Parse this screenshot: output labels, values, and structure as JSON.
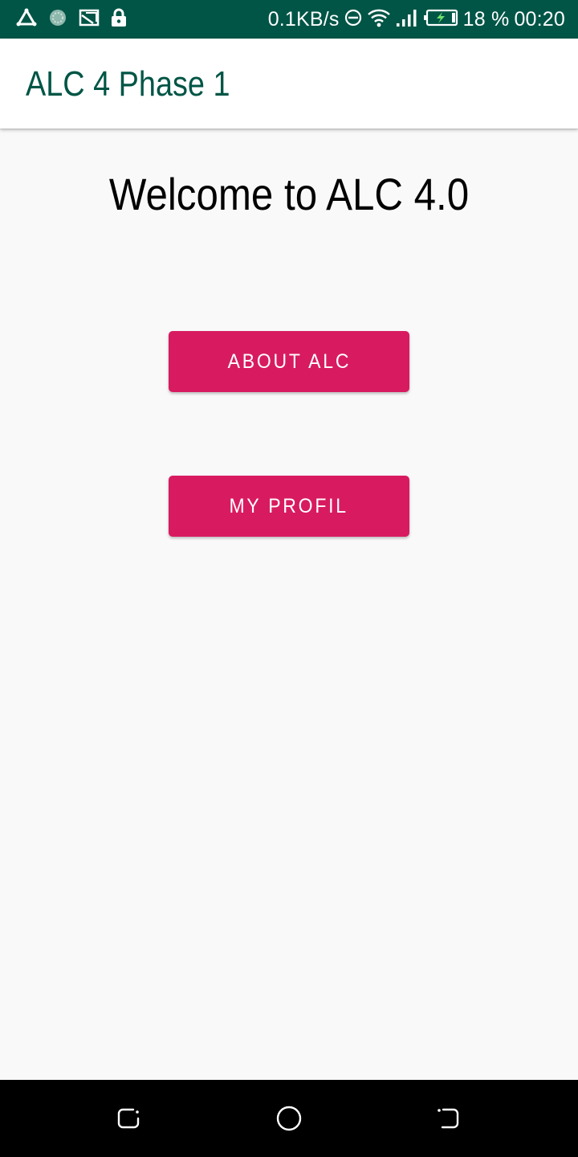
{
  "status_bar": {
    "left_icons": [
      "triangle-icon",
      "sync-icon",
      "cast-icon",
      "lock-icon"
    ],
    "network_speed": "0.1KB/s",
    "right_icons": [
      "do-not-disturb-icon",
      "wifi-icon",
      "signal-icon",
      "battery-charging-icon"
    ],
    "battery_percent": "18 %",
    "time": "00:20",
    "background": "#005546"
  },
  "app_bar": {
    "title": "ALC 4 Phase 1",
    "title_color": "#005546"
  },
  "main": {
    "welcome_text": "Welcome to ALC 4.0",
    "buttons": [
      {
        "label": "ABOUT ALC"
      },
      {
        "label": "MY PROFIL"
      }
    ],
    "button_color": "#d81b60"
  },
  "nav_bar": {
    "icons": [
      "recent-apps-icon",
      "home-icon",
      "back-icon"
    ]
  }
}
